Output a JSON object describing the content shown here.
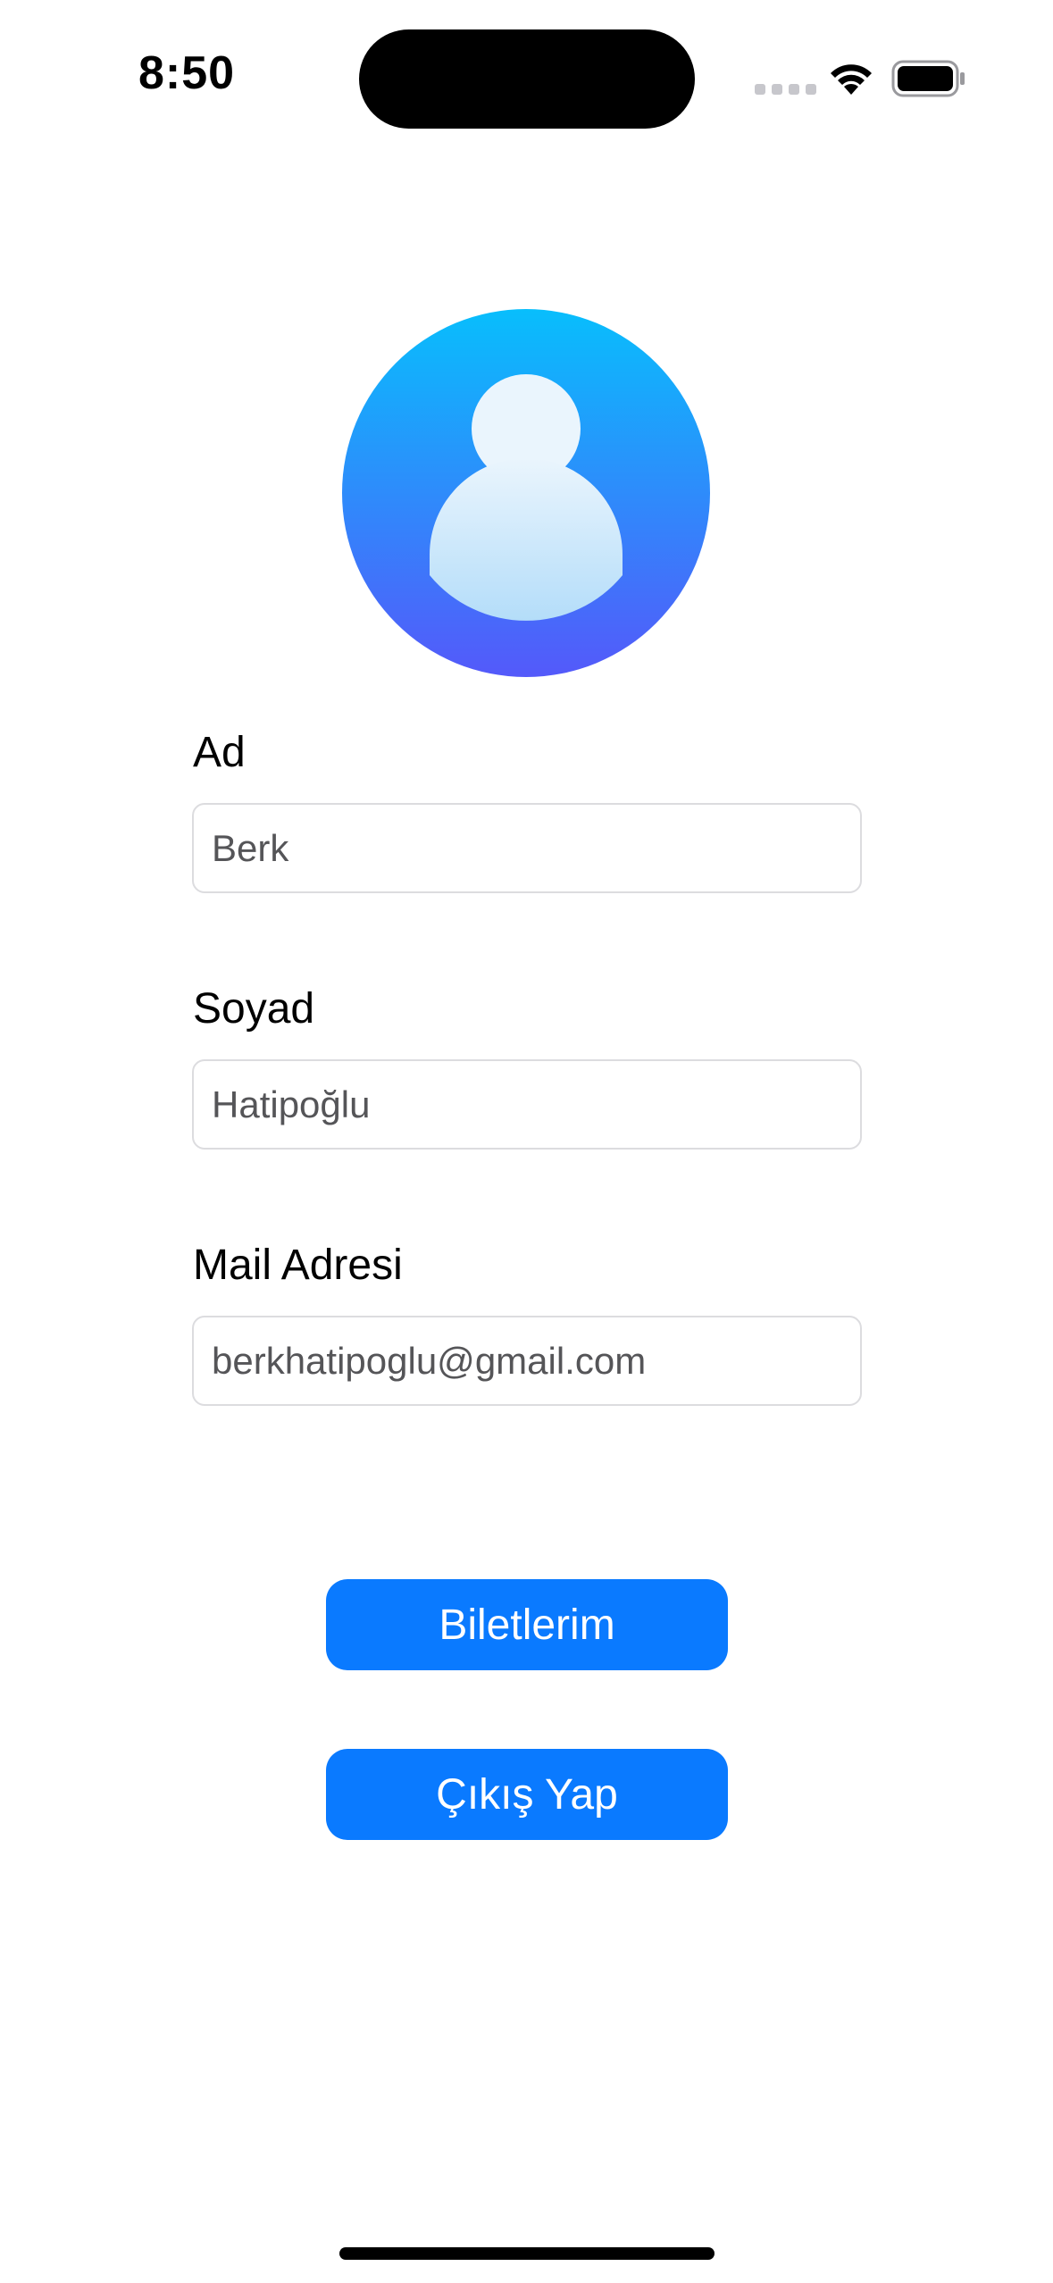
{
  "status_bar": {
    "time": "8:50",
    "icons": [
      "cellular-signal-icon",
      "wifi-icon",
      "battery-icon"
    ]
  },
  "profile": {
    "avatar_icon": "person-circle-icon",
    "colors": {
      "avatar_top": "#08BEFC",
      "avatar_bottom": "#5459FA",
      "button": "#0A7AFF"
    }
  },
  "form": {
    "first_name": {
      "label": "Ad",
      "value": "Berk"
    },
    "last_name": {
      "label": "Soyad",
      "value": "Hatipoğlu"
    },
    "email": {
      "label": "Mail Adresi",
      "value": "berkhatipoglu@gmail.com"
    }
  },
  "actions": {
    "tickets_label": "Biletlerim",
    "logout_label": "Çıkış Yap"
  }
}
